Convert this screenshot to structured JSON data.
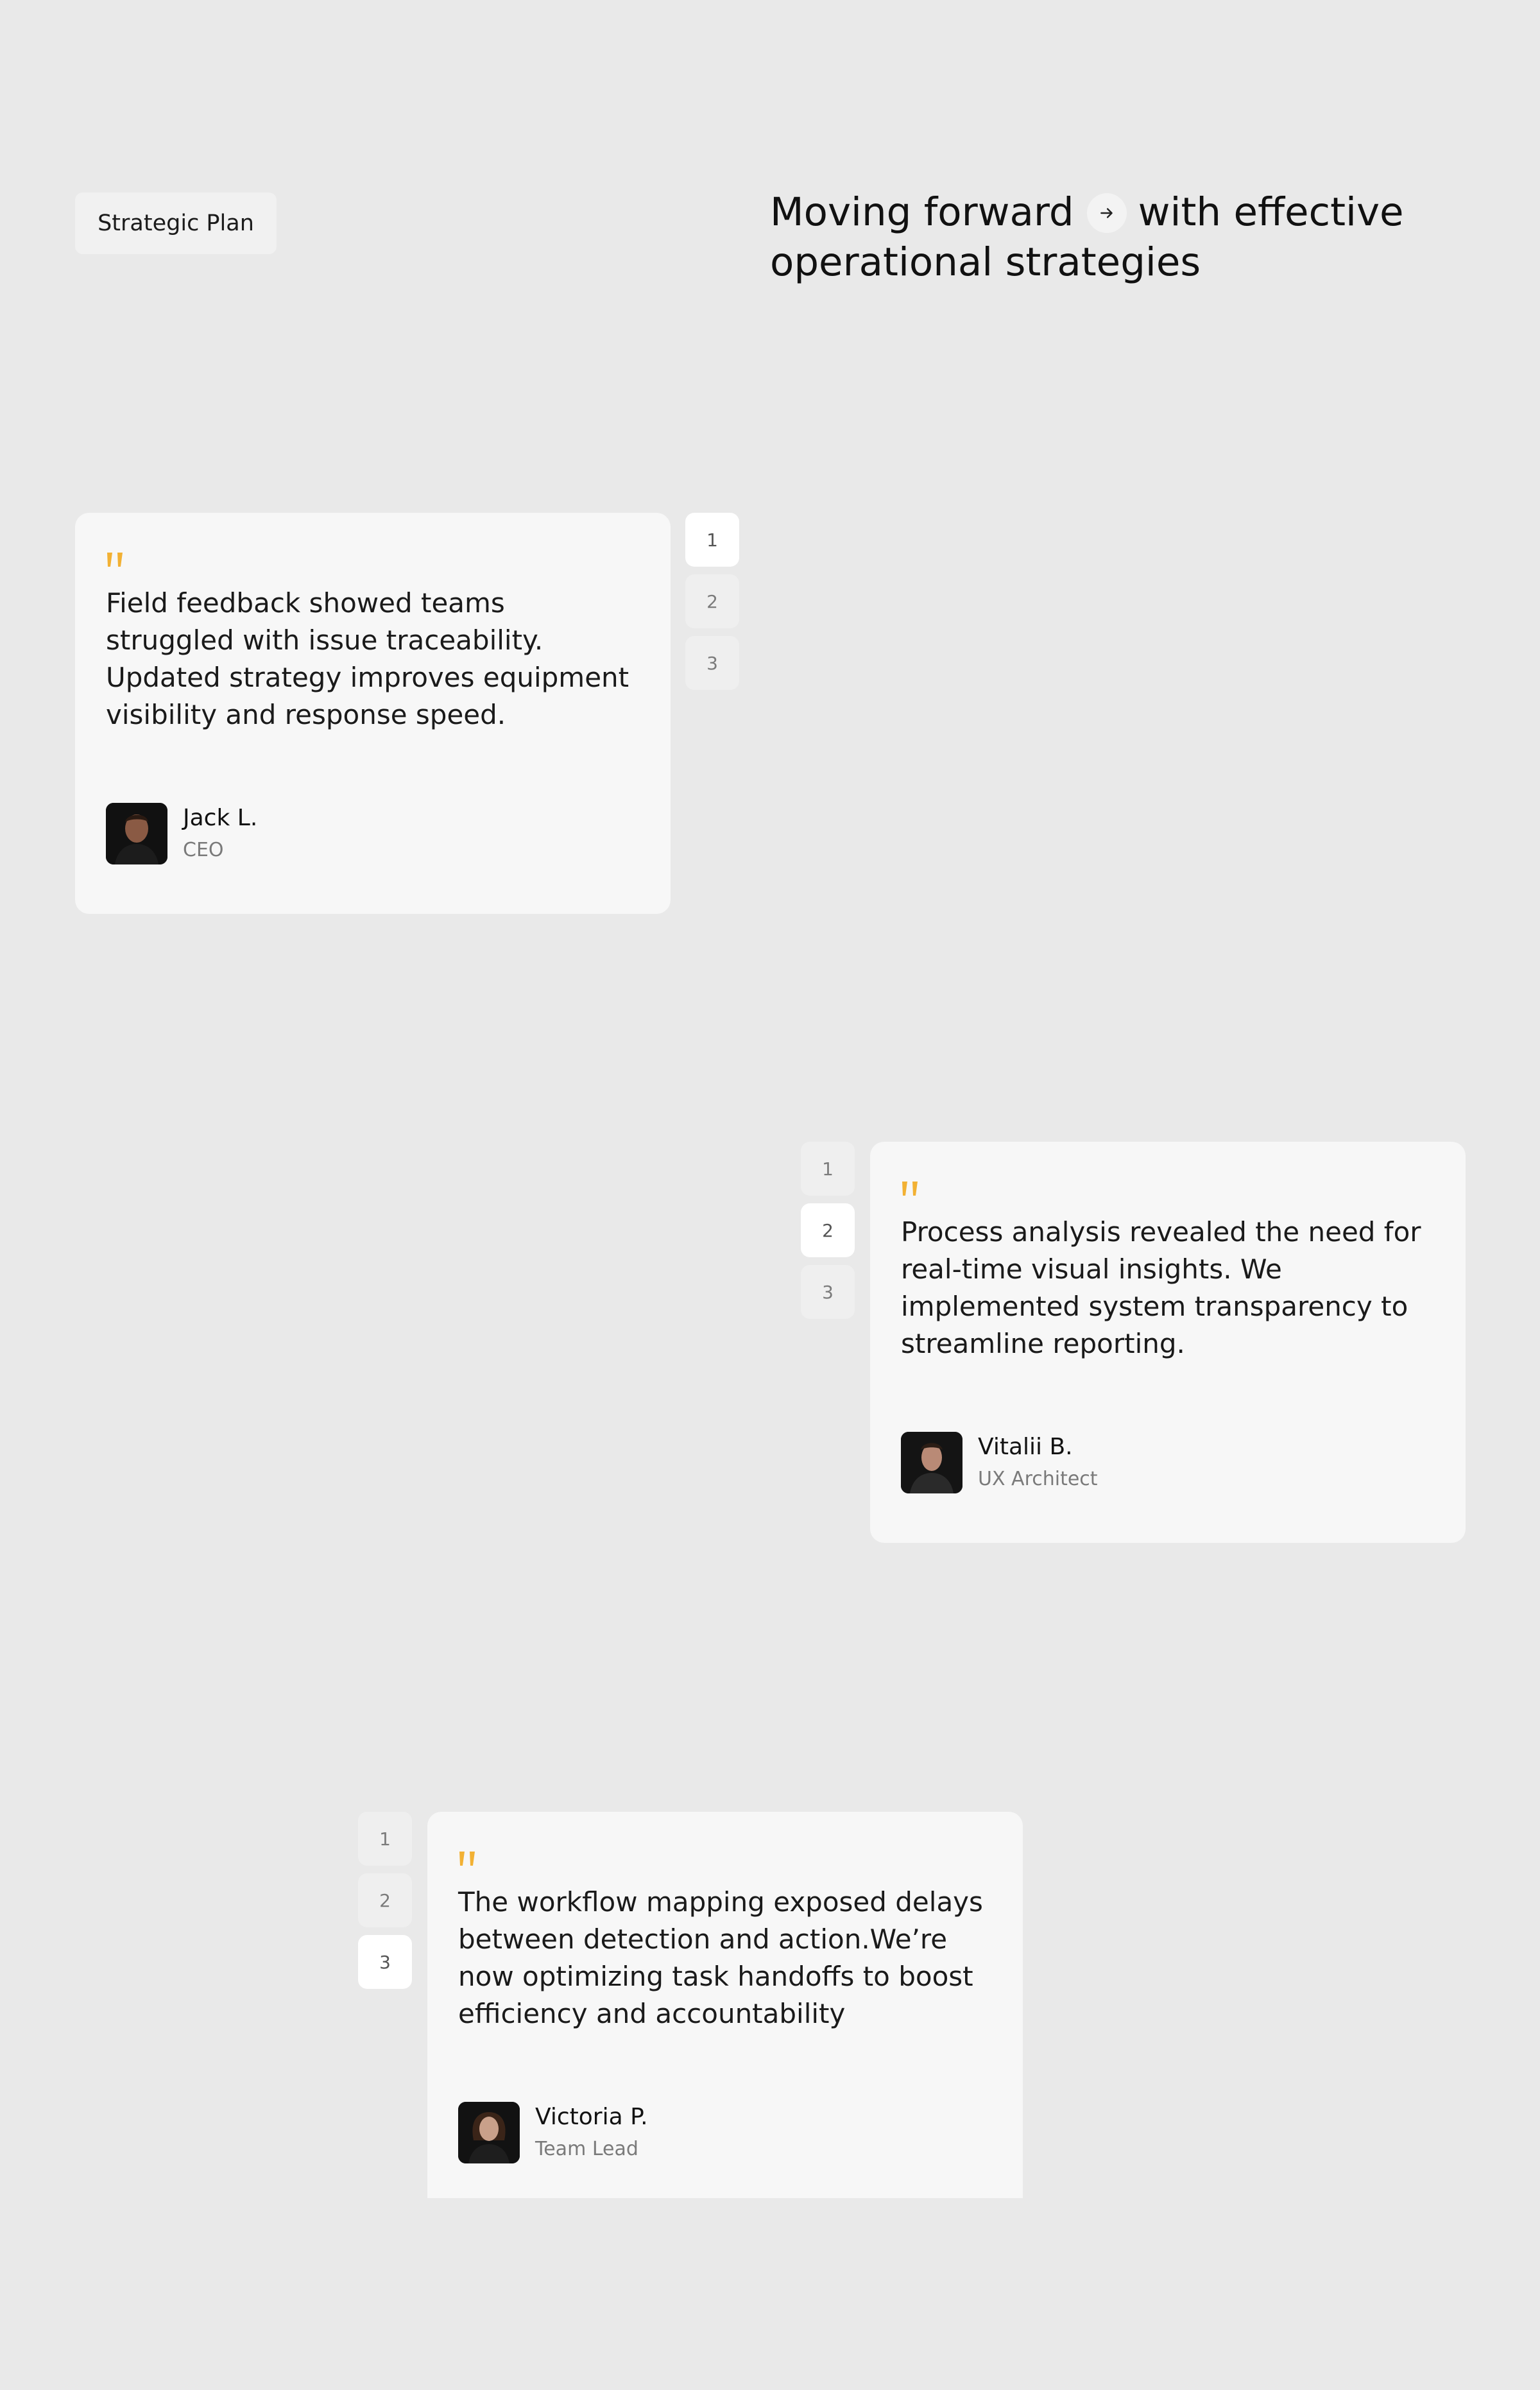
{
  "header": {
    "tag_label": "Strategic Plan",
    "headline_part1": "Moving forward",
    "headline_part2": "with effective",
    "headline_part3": "operational strategies",
    "arrow_icon": "arrow-right-icon"
  },
  "colors": {
    "page_background": "#e9e9e9",
    "card_background": "#f7f7f7",
    "quote_accent": "#f2b134",
    "active_page_button": "#ffffff",
    "inactive_page_button": "#efefef"
  },
  "testimonials": [
    {
      "quote": "Field feedback showed teams struggled with issue traceability. Updated strategy improves equipment visibility and response speed.",
      "name": "Jack L.",
      "role": "CEO",
      "pages": [
        "1",
        "2",
        "3"
      ],
      "active_page": 1
    },
    {
      "quote": "Process analysis revealed the need for real-time visual insights. We implemented system transparency to streamline reporting.",
      "name": "Vitalii B.",
      "role": "UX Architect",
      "pages": [
        "1",
        "2",
        "3"
      ],
      "active_page": 2
    },
    {
      "quote": "The workflow mapping exposed delays between detection and action.We’re now optimizing task handoffs to boost efficiency and accountability",
      "name": "Victoria P.",
      "role": "Team Lead",
      "pages": [
        "1",
        "2",
        "3"
      ],
      "active_page": 3
    }
  ]
}
